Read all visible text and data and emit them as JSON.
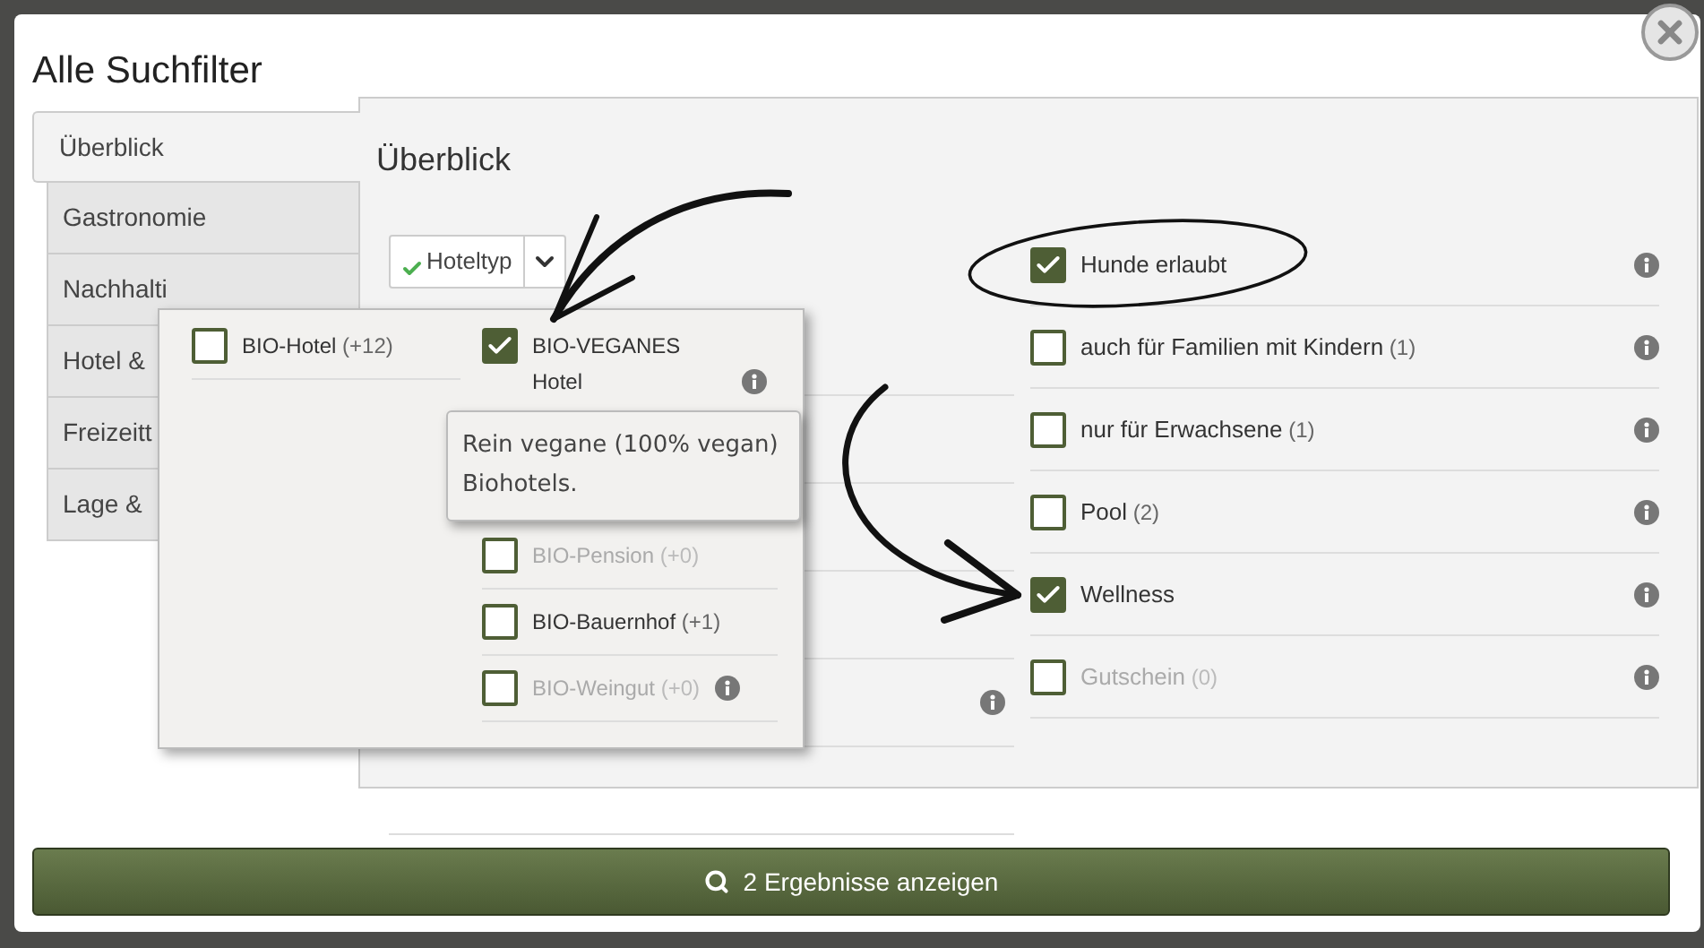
{
  "dialog": {
    "title": "Alle Suchfilter"
  },
  "tabs": [
    {
      "label": "Überblick",
      "selected": true
    },
    {
      "label": "Gastronomie",
      "selected": false
    },
    {
      "label": "Nachhalti",
      "selected": false
    },
    {
      "label": "Hotel &",
      "selected": false
    },
    {
      "label": "Freizeitt",
      "selected": false
    },
    {
      "label": "Lage &",
      "selected": false
    }
  ],
  "panel": {
    "heading": "Überblick",
    "dropdown": {
      "label": "Hoteltyp",
      "active": true
    }
  },
  "popup": {
    "left": [
      {
        "label": "BIO-Hotel",
        "count": "(+12)",
        "checked": false,
        "disabled": false,
        "info": false
      }
    ],
    "right": [
      {
        "label": "BIO-VEGANES Hotel",
        "checked": true,
        "disabled": false,
        "info": true
      },
      {
        "label": "BIO-Pension",
        "count": "(+0)",
        "checked": false,
        "disabled": true,
        "info": false
      },
      {
        "label": "BIO-Bauernhof",
        "count": "(+1)",
        "checked": false,
        "disabled": false,
        "info": false
      },
      {
        "label": "BIO-Weingut",
        "count": "(+0)",
        "checked": false,
        "disabled": true,
        "info": true
      }
    ],
    "tooltip": "Rein vegane (100% vegan) Biohotels."
  },
  "features": [
    {
      "label": "Hunde erlaubt",
      "checked": true,
      "disabled": false
    },
    {
      "label": "auch für Familien mit Kindern",
      "count": "(1)",
      "checked": false,
      "disabled": false
    },
    {
      "label": "nur für Erwachsene",
      "count": "(1)",
      "checked": false,
      "disabled": false
    },
    {
      "label": "Pool",
      "count": "(2)",
      "checked": false,
      "disabled": false
    },
    {
      "label": "Wellness",
      "checked": true,
      "disabled": false
    },
    {
      "label": "Gutschein",
      "count": "(0)",
      "checked": false,
      "disabled": true
    }
  ],
  "search_button": "2 Ergebnisse anzeigen"
}
